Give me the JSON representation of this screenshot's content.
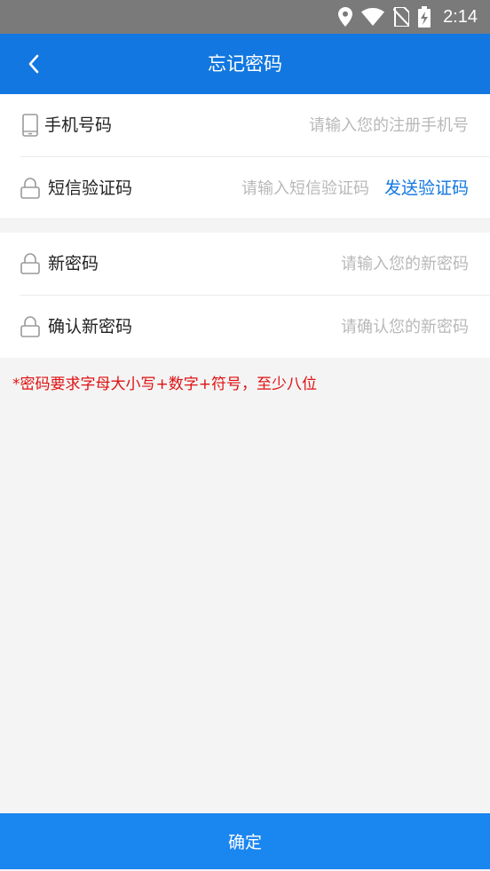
{
  "status_bar": {
    "time": "2:14",
    "icons": [
      "location-icon",
      "wifi-icon",
      "no-sim-icon",
      "battery-charging-icon"
    ]
  },
  "header": {
    "back_icon": "chevron-left-icon",
    "title": "忘记密码"
  },
  "form": {
    "phone": {
      "icon": "phone-icon",
      "label": "手机号码",
      "value": "",
      "placeholder": "请输入您的注册手机号"
    },
    "sms_code": {
      "icon": "lock-icon",
      "label": "短信验证码",
      "value": "",
      "placeholder": "请输入短信验证码",
      "send_label": "发送验证码"
    },
    "new_password": {
      "icon": "lock-icon",
      "label": "新密码",
      "value": "",
      "placeholder": "请输入您的新密码"
    },
    "confirm_password": {
      "icon": "lock-icon",
      "label": "确认新密码",
      "value": "",
      "placeholder": "请确认您的新密码"
    }
  },
  "hint": "*密码要求字母大小写+数字+符号，至少八位",
  "confirm_label": "确定",
  "colors": {
    "accent": "#1277e0",
    "button": "#1a86f0",
    "hint": "#e01010",
    "status_bar": "#7a7a7a",
    "background": "#f4f4f4"
  }
}
